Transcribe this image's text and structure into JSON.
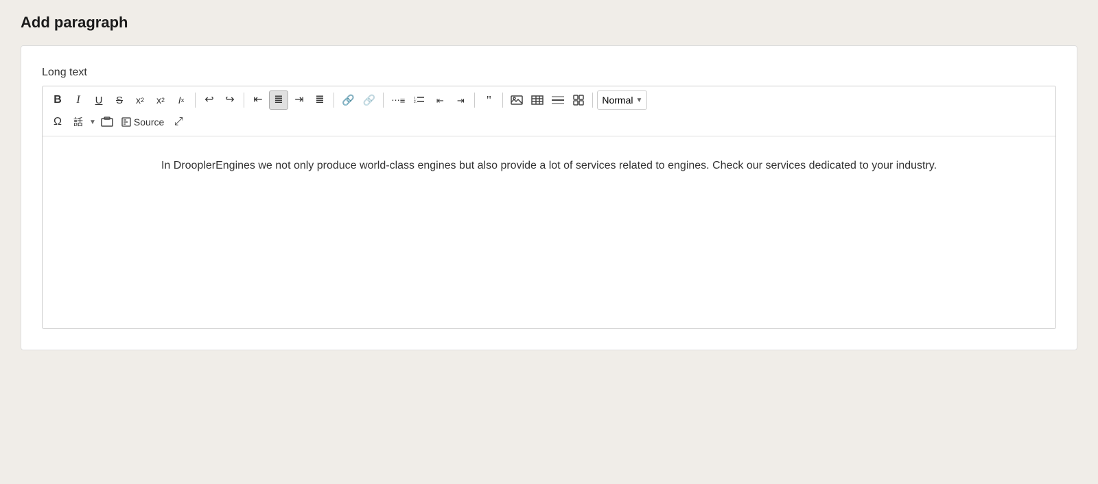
{
  "page": {
    "title": "Add paragraph"
  },
  "field": {
    "label": "Long text"
  },
  "toolbar": {
    "row1": {
      "bold": "B",
      "italic": "I",
      "underline": "U",
      "strikethrough": "S",
      "superscript_label": "x",
      "superscript_sup": "2",
      "subscript_label": "x",
      "subscript_sub": "2",
      "clear_format": "Ix",
      "undo": "↩",
      "redo": "↪",
      "align_left": "≡",
      "align_center": "≡",
      "align_right": "≡",
      "align_justify": "≡",
      "link": "🔗",
      "unlink": "⛓",
      "bullet_list": "≔",
      "numbered_list": "≔",
      "indent": "⇥",
      "outdent": "⇤",
      "blockquote": "❝❝",
      "image": "🖼",
      "table": "⊞",
      "horizontal_rule": "—",
      "special_chars2": "⊡",
      "dropdown_label": "Normal",
      "dropdown_arrow": "▼"
    },
    "row2": {
      "omega": "Ω",
      "cjk": "話",
      "cjk_dropdown": "▼",
      "screenshot": "⊡",
      "source": "Source",
      "fullscreen": "⤢"
    }
  },
  "editor": {
    "content": "In DrooplerEngines we not only produce world-class engines but also provide a lot of services related to engines. Check our services dedicated to your industry."
  }
}
